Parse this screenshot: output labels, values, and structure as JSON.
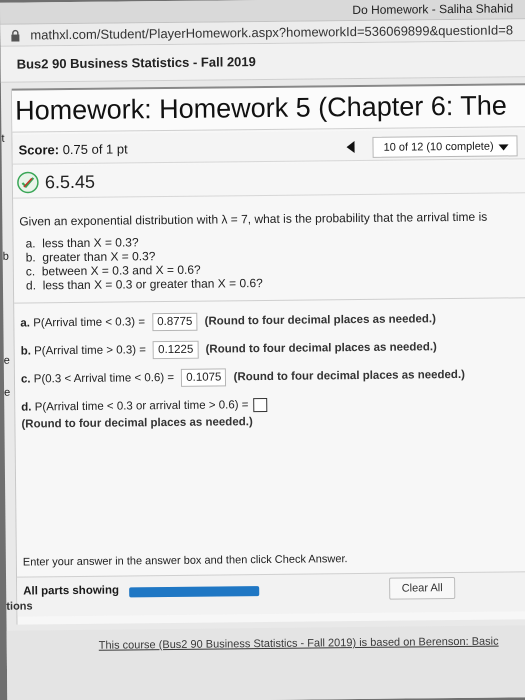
{
  "window": {
    "title": "Do Homework - Saliha Shahid"
  },
  "address_bar": {
    "url": "mathxl.com/Student/PlayerHomework.aspx?homeworkId=536069899&questionId=8"
  },
  "course": {
    "name": "Bus2 90 Business Statistics - Fall 2019"
  },
  "homework": {
    "title": "Homework: Homework 5 (Chapter 6: The"
  },
  "score": {
    "label": "Score:",
    "value": "0.75 of 1 pt"
  },
  "nav": {
    "position": "10 of 12 (10 complete)"
  },
  "problem": {
    "number": "6.5.45",
    "question": "Given an exponential distribution with λ = 7, what is the probability that the arrival time is",
    "parts": [
      {
        "label": "a.",
        "text": "less than X = 0.3?"
      },
      {
        "label": "b.",
        "text": "greater than X = 0.3?"
      },
      {
        "label": "c.",
        "text": "between X = 0.3 and X = 0.6?"
      },
      {
        "label": "d.",
        "text": "less than X = 0.3 or greater than X = 0.6?"
      }
    ]
  },
  "answers": [
    {
      "label": "a.",
      "expr": "P(Arrival time < 0.3) =",
      "value": "0.8775",
      "hint": "(Round to four decimal places as needed.)"
    },
    {
      "label": "b.",
      "expr": "P(Arrival time > 0.3) =",
      "value": "0.1225",
      "hint": "(Round to four decimal places as needed.)"
    },
    {
      "label": "c.",
      "expr": "P(0.3 < Arrival time < 0.6) =",
      "value": "0.1075",
      "hint": "(Round to four decimal places as needed.)"
    },
    {
      "label": "d.",
      "expr": "P(Arrival time < 0.3 or arrival time > 0.6) =",
      "value": "",
      "hint": "(Round to four decimal places as needed.)"
    }
  ],
  "instructions": "Enter your answer in the answer box and then click Check Answer.",
  "bottom": {
    "all_parts": "All parts showing",
    "progress_fraction": 1.0,
    "clear_label": "Clear All"
  },
  "left_edge": {
    "marks": [
      "t",
      "b",
      "e",
      "e"
    ],
    "tions": "tions"
  },
  "footer": {
    "text": "This course (Bus2 90 Business Statistics - Fall 2019) is based on Berenson: Basic"
  },
  "colors": {
    "progress": "#1f77c4",
    "badge": "#3aa657"
  },
  "icons": {
    "lock": "lock-icon",
    "prev": "prev-arrow-icon",
    "dropdown": "dropdown-icon",
    "badge": "partial-credit-icon"
  }
}
